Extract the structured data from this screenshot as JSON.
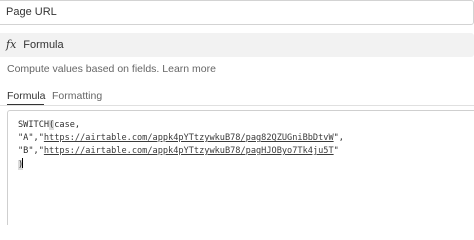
{
  "field": {
    "name": "Page URL"
  },
  "type_select": {
    "icon": "fx-icon",
    "label": "Formula"
  },
  "description": {
    "text": "Compute values based on fields.",
    "link": "Learn more"
  },
  "tabs": [
    {
      "label": "Formula",
      "active": true
    },
    {
      "label": "Formatting",
      "active": false
    }
  ],
  "formula": {
    "line1_fn": "SWITCH",
    "line1_open": "(",
    "line1_rest": "case,",
    "line2_key": "\"A\",\"",
    "line2_url": "https://airtable.com/appk4pYTtzywkuB78/pag82QZUGniBbDtvW",
    "line2_end": "\",",
    "line3_key": "\"B\",\"",
    "line3_url": "https://airtable.com/appk4pYTtzywkuB78/pagHJOByo7Tk4ju5T",
    "line3_end": "\"",
    "line4": ")"
  }
}
